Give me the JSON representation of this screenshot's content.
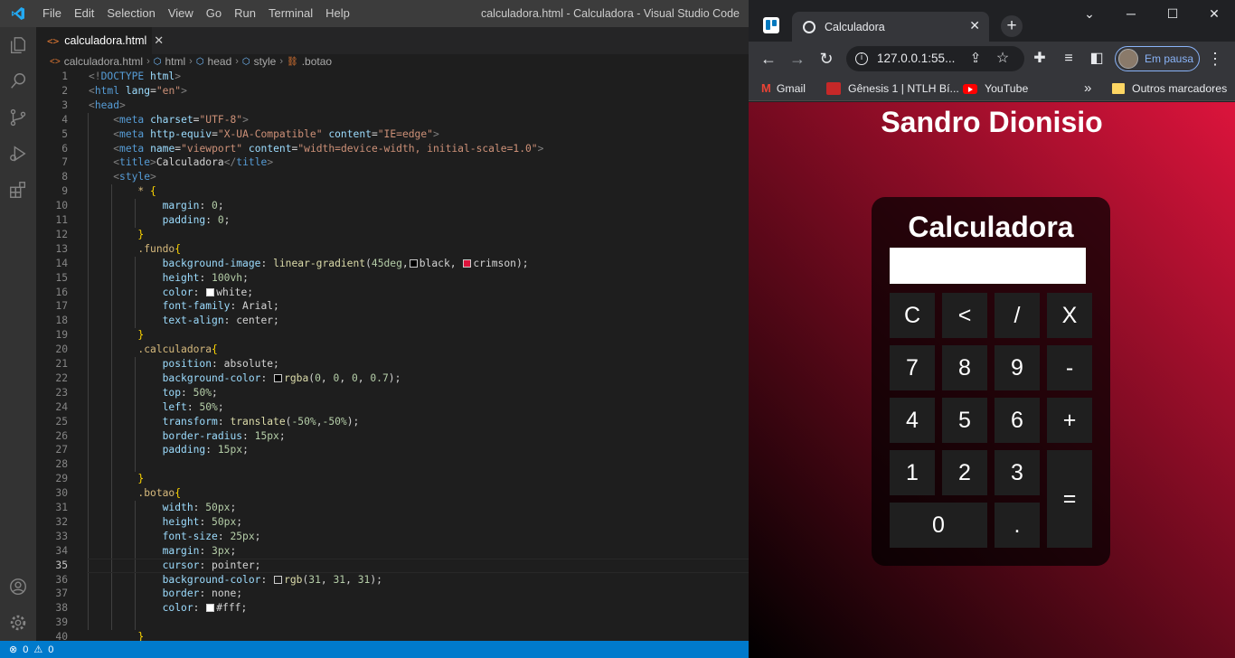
{
  "vscode": {
    "menu": [
      "File",
      "Edit",
      "Selection",
      "View",
      "Go",
      "Run",
      "Terminal",
      "Help"
    ],
    "window_title": "calculadora.html - Calculadora - Visual Studio Code",
    "tab_label": "calculadora.html",
    "breadcrumb": [
      "calculadora.html",
      "html",
      "head",
      "style",
      ".botao"
    ],
    "current_line": 35,
    "lines": [
      [
        {
          "c": "t-br",
          "t": "<!"
        },
        {
          "c": "t-tag",
          "t": "DOCTYPE"
        },
        {
          "c": "",
          "t": " "
        },
        {
          "c": "t-attr",
          "t": "html"
        },
        {
          "c": "t-br",
          "t": ">"
        }
      ],
      [
        {
          "c": "t-br",
          "t": "<"
        },
        {
          "c": "t-tag",
          "t": "html"
        },
        {
          "c": "",
          "t": " "
        },
        {
          "c": "t-attr",
          "t": "lang"
        },
        {
          "c": "",
          "t": "="
        },
        {
          "c": "t-str",
          "t": "\"en\""
        },
        {
          "c": "t-br",
          "t": ">"
        }
      ],
      [
        {
          "c": "t-br",
          "t": "<"
        },
        {
          "c": "t-tag",
          "t": "head"
        },
        {
          "c": "t-br",
          "t": ">"
        }
      ],
      [
        {
          "c": "",
          "t": "    "
        },
        {
          "c": "t-br",
          "t": "<"
        },
        {
          "c": "t-tag",
          "t": "meta"
        },
        {
          "c": "",
          "t": " "
        },
        {
          "c": "t-attr",
          "t": "charset"
        },
        {
          "c": "",
          "t": "="
        },
        {
          "c": "t-str",
          "t": "\"UTF-8\""
        },
        {
          "c": "t-br",
          "t": ">"
        }
      ],
      [
        {
          "c": "",
          "t": "    "
        },
        {
          "c": "t-br",
          "t": "<"
        },
        {
          "c": "t-tag",
          "t": "meta"
        },
        {
          "c": "",
          "t": " "
        },
        {
          "c": "t-attr",
          "t": "http-equiv"
        },
        {
          "c": "",
          "t": "="
        },
        {
          "c": "t-str",
          "t": "\"X-UA-Compatible\""
        },
        {
          "c": "",
          "t": " "
        },
        {
          "c": "t-attr",
          "t": "content"
        },
        {
          "c": "",
          "t": "="
        },
        {
          "c": "t-str",
          "t": "\"IE=edge\""
        },
        {
          "c": "t-br",
          "t": ">"
        }
      ],
      [
        {
          "c": "",
          "t": "    "
        },
        {
          "c": "t-br",
          "t": "<"
        },
        {
          "c": "t-tag",
          "t": "meta"
        },
        {
          "c": "",
          "t": " "
        },
        {
          "c": "t-attr",
          "t": "name"
        },
        {
          "c": "",
          "t": "="
        },
        {
          "c": "t-str",
          "t": "\"viewport\""
        },
        {
          "c": "",
          "t": " "
        },
        {
          "c": "t-attr",
          "t": "content"
        },
        {
          "c": "",
          "t": "="
        },
        {
          "c": "t-str",
          "t": "\"width=device-width, initial-scale=1.0\""
        },
        {
          "c": "t-br",
          "t": ">"
        }
      ],
      [
        {
          "c": "",
          "t": "    "
        },
        {
          "c": "t-br",
          "t": "<"
        },
        {
          "c": "t-tag",
          "t": "title"
        },
        {
          "c": "t-br",
          "t": ">"
        },
        {
          "c": "",
          "t": "Calculadora"
        },
        {
          "c": "t-br",
          "t": "</"
        },
        {
          "c": "t-tag",
          "t": "title"
        },
        {
          "c": "t-br",
          "t": ">"
        }
      ],
      [
        {
          "c": "",
          "t": "    "
        },
        {
          "c": "t-br",
          "t": "<"
        },
        {
          "c": "t-tag",
          "t": "style"
        },
        {
          "c": "t-br",
          "t": ">"
        }
      ],
      [
        {
          "c": "",
          "t": "        "
        },
        {
          "c": "t-sel",
          "t": "*"
        },
        {
          "c": "",
          "t": " "
        },
        {
          "c": "t-brace",
          "t": "{"
        }
      ],
      [
        {
          "c": "",
          "t": "            "
        },
        {
          "c": "t-prop",
          "t": "margin"
        },
        {
          "c": "",
          "t": ": "
        },
        {
          "c": "t-num",
          "t": "0"
        },
        {
          "c": "",
          "t": ";"
        }
      ],
      [
        {
          "c": "",
          "t": "            "
        },
        {
          "c": "t-prop",
          "t": "padding"
        },
        {
          "c": "",
          "t": ": "
        },
        {
          "c": "t-num",
          "t": "0"
        },
        {
          "c": "",
          "t": ";"
        }
      ],
      [
        {
          "c": "",
          "t": "        "
        },
        {
          "c": "t-brace",
          "t": "}"
        }
      ],
      [
        {
          "c": "",
          "t": "        "
        },
        {
          "c": "t-sel",
          "t": ".fundo"
        },
        {
          "c": "t-brace",
          "t": "{"
        }
      ],
      [
        {
          "c": "",
          "t": "            "
        },
        {
          "c": "t-prop",
          "t": "background-image"
        },
        {
          "c": "",
          "t": ": "
        },
        {
          "c": "t-fn",
          "t": "linear-gradient"
        },
        {
          "c": "",
          "t": "("
        },
        {
          "c": "t-num",
          "t": "45deg"
        },
        {
          "c": "",
          "t": ","
        },
        {
          "c": "sw",
          "t": "#000000"
        },
        {
          "c": "",
          "t": "black, "
        },
        {
          "c": "sw",
          "t": "#dc143c"
        },
        {
          "c": "",
          "t": "crimson);"
        }
      ],
      [
        {
          "c": "",
          "t": "            "
        },
        {
          "c": "t-prop",
          "t": "height"
        },
        {
          "c": "",
          "t": ": "
        },
        {
          "c": "t-num",
          "t": "100vh"
        },
        {
          "c": "",
          "t": ";"
        }
      ],
      [
        {
          "c": "",
          "t": "            "
        },
        {
          "c": "t-prop",
          "t": "color"
        },
        {
          "c": "",
          "t": ": "
        },
        {
          "c": "sw",
          "t": "#ffffff"
        },
        {
          "c": "",
          "t": "white;"
        }
      ],
      [
        {
          "c": "",
          "t": "            "
        },
        {
          "c": "t-prop",
          "t": "font-family"
        },
        {
          "c": "",
          "t": ": Arial;"
        }
      ],
      [
        {
          "c": "",
          "t": "            "
        },
        {
          "c": "t-prop",
          "t": "text-align"
        },
        {
          "c": "",
          "t": ": center;"
        }
      ],
      [
        {
          "c": "",
          "t": "        "
        },
        {
          "c": "t-brace",
          "t": "}"
        }
      ],
      [
        {
          "c": "",
          "t": "        "
        },
        {
          "c": "t-sel",
          "t": ".calculadora"
        },
        {
          "c": "t-brace",
          "t": "{"
        }
      ],
      [
        {
          "c": "",
          "t": "            "
        },
        {
          "c": "t-prop",
          "t": "position"
        },
        {
          "c": "",
          "t": ": absolute;"
        }
      ],
      [
        {
          "c": "",
          "t": "            "
        },
        {
          "c": "t-prop",
          "t": "background-color"
        },
        {
          "c": "",
          "t": ": "
        },
        {
          "c": "sw",
          "t": "#000000"
        },
        {
          "c": "t-fn",
          "t": "rgba"
        },
        {
          "c": "",
          "t": "("
        },
        {
          "c": "t-num",
          "t": "0"
        },
        {
          "c": "",
          "t": ", "
        },
        {
          "c": "t-num",
          "t": "0"
        },
        {
          "c": "",
          "t": ", "
        },
        {
          "c": "t-num",
          "t": "0"
        },
        {
          "c": "",
          "t": ", "
        },
        {
          "c": "t-num",
          "t": "0.7"
        },
        {
          "c": "",
          "t": ");"
        }
      ],
      [
        {
          "c": "",
          "t": "            "
        },
        {
          "c": "t-prop",
          "t": "top"
        },
        {
          "c": "",
          "t": ": "
        },
        {
          "c": "t-num",
          "t": "50%"
        },
        {
          "c": "",
          "t": ";"
        }
      ],
      [
        {
          "c": "",
          "t": "            "
        },
        {
          "c": "t-prop",
          "t": "left"
        },
        {
          "c": "",
          "t": ": "
        },
        {
          "c": "t-num",
          "t": "50%"
        },
        {
          "c": "",
          "t": ";"
        }
      ],
      [
        {
          "c": "",
          "t": "            "
        },
        {
          "c": "t-prop",
          "t": "transform"
        },
        {
          "c": "",
          "t": ": "
        },
        {
          "c": "t-fn",
          "t": "translate"
        },
        {
          "c": "",
          "t": "("
        },
        {
          "c": "t-num",
          "t": "-50%"
        },
        {
          "c": "",
          "t": ","
        },
        {
          "c": "t-num",
          "t": "-50%"
        },
        {
          "c": "",
          "t": ");"
        }
      ],
      [
        {
          "c": "",
          "t": "            "
        },
        {
          "c": "t-prop",
          "t": "border-radius"
        },
        {
          "c": "",
          "t": ": "
        },
        {
          "c": "t-num",
          "t": "15px"
        },
        {
          "c": "",
          "t": ";"
        }
      ],
      [
        {
          "c": "",
          "t": "            "
        },
        {
          "c": "t-prop",
          "t": "padding"
        },
        {
          "c": "",
          "t": ": "
        },
        {
          "c": "t-num",
          "t": "15px"
        },
        {
          "c": "",
          "t": ";"
        }
      ],
      [],
      [
        {
          "c": "",
          "t": "        "
        },
        {
          "c": "t-brace",
          "t": "}"
        }
      ],
      [
        {
          "c": "",
          "t": "        "
        },
        {
          "c": "t-sel",
          "t": ".botao"
        },
        {
          "c": "t-brace",
          "t": "{"
        }
      ],
      [
        {
          "c": "",
          "t": "            "
        },
        {
          "c": "t-prop",
          "t": "width"
        },
        {
          "c": "",
          "t": ": "
        },
        {
          "c": "t-num",
          "t": "50px"
        },
        {
          "c": "",
          "t": ";"
        }
      ],
      [
        {
          "c": "",
          "t": "            "
        },
        {
          "c": "t-prop",
          "t": "height"
        },
        {
          "c": "",
          "t": ": "
        },
        {
          "c": "t-num",
          "t": "50px"
        },
        {
          "c": "",
          "t": ";"
        }
      ],
      [
        {
          "c": "",
          "t": "            "
        },
        {
          "c": "t-prop",
          "t": "font-size"
        },
        {
          "c": "",
          "t": ": "
        },
        {
          "c": "t-num",
          "t": "25px"
        },
        {
          "c": "",
          "t": ";"
        }
      ],
      [
        {
          "c": "",
          "t": "            "
        },
        {
          "c": "t-prop",
          "t": "margin"
        },
        {
          "c": "",
          "t": ": "
        },
        {
          "c": "t-num",
          "t": "3px"
        },
        {
          "c": "",
          "t": ";"
        }
      ],
      [
        {
          "c": "",
          "t": "            "
        },
        {
          "c": "t-prop",
          "t": "cursor"
        },
        {
          "c": "",
          "t": ": pointer;"
        }
      ],
      [
        {
          "c": "",
          "t": "            "
        },
        {
          "c": "t-prop",
          "t": "background-color"
        },
        {
          "c": "",
          "t": ": "
        },
        {
          "c": "sw",
          "t": "#1f1f1f"
        },
        {
          "c": "t-fn",
          "t": "rgb"
        },
        {
          "c": "",
          "t": "("
        },
        {
          "c": "t-num",
          "t": "31"
        },
        {
          "c": "",
          "t": ", "
        },
        {
          "c": "t-num",
          "t": "31"
        },
        {
          "c": "",
          "t": ", "
        },
        {
          "c": "t-num",
          "t": "31"
        },
        {
          "c": "",
          "t": ");"
        }
      ],
      [
        {
          "c": "",
          "t": "            "
        },
        {
          "c": "t-prop",
          "t": "border"
        },
        {
          "c": "",
          "t": ": none;"
        }
      ],
      [
        {
          "c": "",
          "t": "            "
        },
        {
          "c": "t-prop",
          "t": "color"
        },
        {
          "c": "",
          "t": ": "
        },
        {
          "c": "sw",
          "t": "#ffffff"
        },
        {
          "c": "",
          "t": "#fff;"
        }
      ],
      [],
      [
        {
          "c": "",
          "t": "        "
        },
        {
          "c": "t-brace",
          "t": "}"
        }
      ]
    ],
    "status_errors": "0",
    "status_warnings": "0"
  },
  "chrome": {
    "tab_title": "Calculadora",
    "url": "127.0.0.1:55...",
    "profile_label": "Em pausa",
    "bookmarks": [
      "Gmail",
      "Gênesis 1 | NTLH Bí...",
      "YouTube"
    ],
    "other_bookmarks": "Outros marcadores"
  },
  "page": {
    "heading": "Sandro Dionisio",
    "calc_title": "Calculadora",
    "display_value": "",
    "buttons": [
      {
        "label": "C",
        "row": 0,
        "col": 0
      },
      {
        "label": "<",
        "row": 0,
        "col": 1
      },
      {
        "label": "/",
        "row": 0,
        "col": 2
      },
      {
        "label": "X",
        "row": 0,
        "col": 3
      },
      {
        "label": "7",
        "row": 1,
        "col": 0
      },
      {
        "label": "8",
        "row": 1,
        "col": 1
      },
      {
        "label": "9",
        "row": 1,
        "col": 2
      },
      {
        "label": "-",
        "row": 1,
        "col": 3
      },
      {
        "label": "4",
        "row": 2,
        "col": 0
      },
      {
        "label": "5",
        "row": 2,
        "col": 1
      },
      {
        "label": "6",
        "row": 2,
        "col": 2
      },
      {
        "label": "+",
        "row": 2,
        "col": 3
      },
      {
        "label": "1",
        "row": 3,
        "col": 0
      },
      {
        "label": "2",
        "row": 3,
        "col": 1
      },
      {
        "label": "3",
        "row": 3,
        "col": 2
      },
      {
        "label": "=",
        "row": 3,
        "col": 3,
        "rowspan": 2
      },
      {
        "label": "0",
        "row": 4,
        "col": 0,
        "colspan": 2
      },
      {
        "label": ".",
        "row": 4,
        "col": 2
      }
    ]
  }
}
